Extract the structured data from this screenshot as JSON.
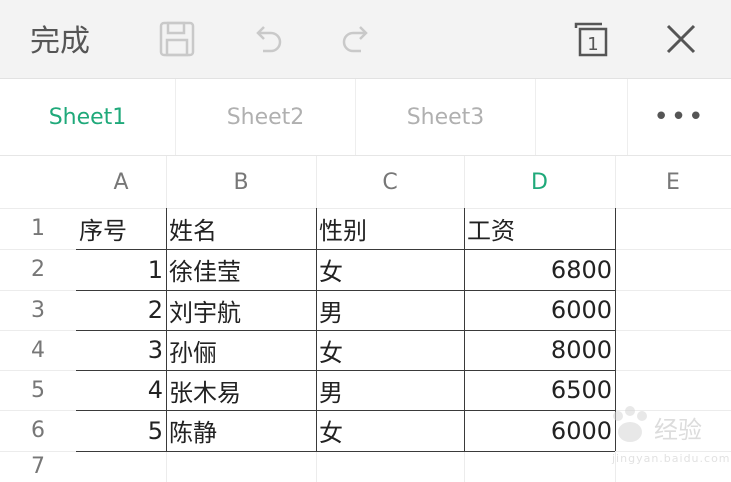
{
  "toolbar": {
    "done_label": "完成",
    "icons": [
      "save-icon",
      "undo-icon",
      "redo-icon",
      "sheet-count-icon",
      "close-icon"
    ],
    "sheet_count": "1"
  },
  "tabs": [
    {
      "label": "Sheet1",
      "active": true
    },
    {
      "label": "Sheet2",
      "active": false
    },
    {
      "label": "Sheet3",
      "active": false
    }
  ],
  "more_label": "•••",
  "columns": [
    "A",
    "B",
    "C",
    "D",
    "E"
  ],
  "selected_column": "D",
  "rows": [
    {
      "num": "1",
      "a": "序号",
      "b": "姓名",
      "c": "性别",
      "d": "工资"
    },
    {
      "num": "2",
      "a": "1",
      "b": "徐佳莹",
      "c": "女",
      "d": "6800"
    },
    {
      "num": "3",
      "a": "2",
      "b": "刘宇航",
      "c": "男",
      "d": "6000"
    },
    {
      "num": "4",
      "a": "3",
      "b": "孙俪",
      "c": "女",
      "d": "8000"
    },
    {
      "num": "5",
      "a": "4",
      "b": "张木易",
      "c": "男",
      "d": "6500"
    },
    {
      "num": "6",
      "a": "5",
      "b": "陈静",
      "c": "女",
      "d": "6000"
    },
    {
      "num": "7",
      "a": "",
      "b": "",
      "c": "",
      "d": ""
    }
  ],
  "watermark": {
    "text": "经验",
    "sub": "jingyan.baidu.com"
  },
  "colors": {
    "accent": "#1fa97a",
    "toolbar_bg": "#f3f3f3"
  }
}
